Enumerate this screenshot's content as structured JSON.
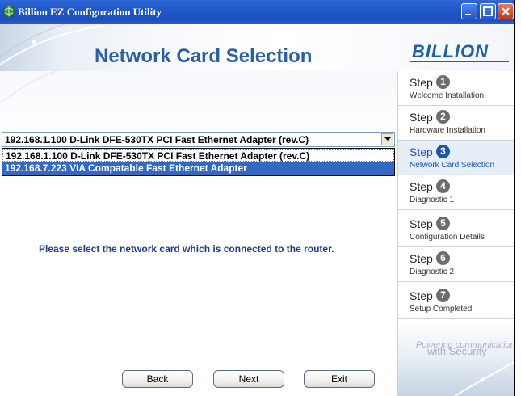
{
  "window": {
    "title": "Billion EZ Configuration Utility",
    "icons": {
      "app": "app-globe-icon",
      "minimize": "minimize-icon",
      "maximize": "maximize-icon",
      "close": "close-icon"
    }
  },
  "header": {
    "title": "Network Card Selection",
    "logo": "BILLION"
  },
  "network": {
    "selected": "192.168.1.100 D-Link DFE-530TX PCI Fast Ethernet Adapter (rev.C)",
    "options": [
      "192.168.1.100 D-Link DFE-530TX PCI Fast Ethernet Adapter (rev.C)",
      "192.168.7.223 VIA Compatable Fast Ethernet Adapter"
    ],
    "highlighted_index": 1
  },
  "instruction": "Please select the network card which is connected to the router.",
  "buttons": {
    "back": "Back",
    "next": "Next",
    "exit": "Exit"
  },
  "steps": [
    {
      "word": "Step",
      "num": "1",
      "label": "Welcome Installation"
    },
    {
      "word": "Step",
      "num": "2",
      "label": "Hardware Installation"
    },
    {
      "word": "Step",
      "num": "3",
      "label": "Network Card Selection",
      "active": true
    },
    {
      "word": "Step",
      "num": "4",
      "label": "Diagnostic 1"
    },
    {
      "word": "Step",
      "num": "5",
      "label": "Configuration Details"
    },
    {
      "word": "Step",
      "num": "6",
      "label": "Diagnostic 2"
    },
    {
      "word": "Step",
      "num": "7",
      "label": "Setup Completed"
    }
  ],
  "tagline": {
    "line1": "Powering communications",
    "line2": "with Security"
  },
  "colors": {
    "titlebar": "#2a63d2",
    "accent": "#1a55b0",
    "highlight": "#316ac5"
  }
}
